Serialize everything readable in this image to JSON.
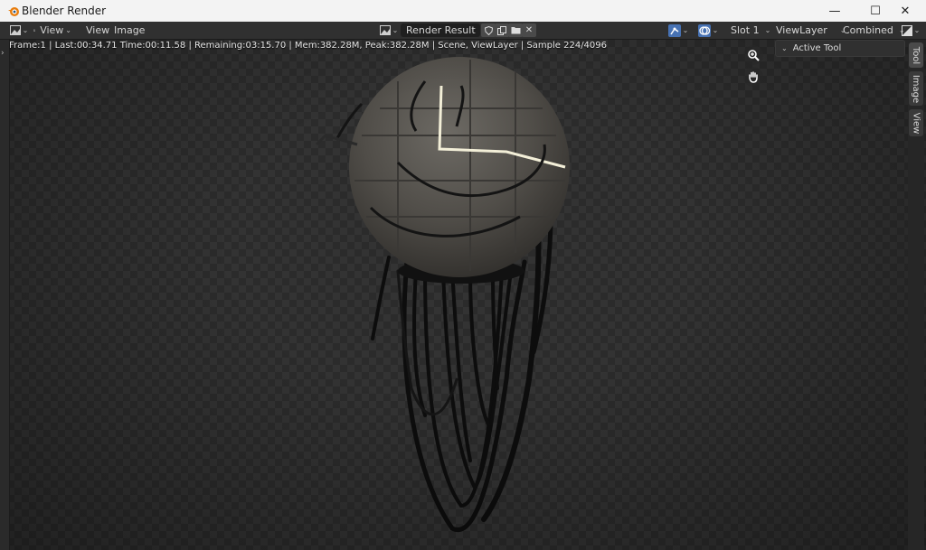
{
  "window": {
    "title": "Blender Render",
    "minimize_glyph": "—",
    "maximize_glyph": "☐",
    "close_glyph": "✕"
  },
  "header": {
    "editor_type_icon": "image-editor-icon",
    "menus": [
      "View",
      "View",
      "Image"
    ],
    "image_name": "Render Result",
    "slot": "Slot 1",
    "view_layer": "ViewLayer",
    "pass": "Combined"
  },
  "stats": {
    "text": "Frame:1 | Last:00:34.71 Time:00:11.58 | Remaining:03:15.70 | Mem:382.28M, Peak:382.28M | Scene, ViewLayer | Sample 224/4096"
  },
  "sidebar": {
    "panel_title": "Active Tool",
    "tabs": [
      "Tool",
      "Image",
      "View"
    ]
  },
  "colors": {
    "accent": "#4772b3",
    "header_bg": "#303030",
    "glow": "#f3efd8"
  }
}
